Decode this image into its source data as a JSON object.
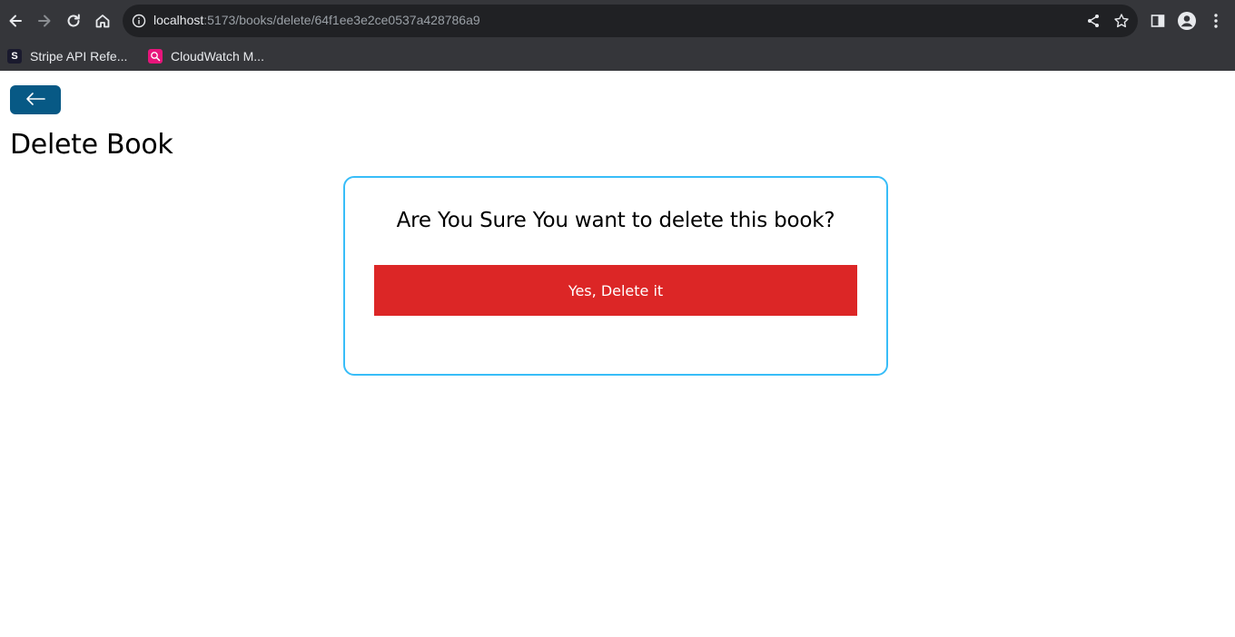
{
  "browser": {
    "url_host": "localhost",
    "url_path": ":5173/books/delete/64f1ee3e2ce0537a428786a9",
    "bookmarks": [
      {
        "label": "Stripe API Refe...",
        "favicon_letter": "S",
        "favicon_color": "#1a1a2e",
        "icon": "stripe-icon"
      },
      {
        "label": "CloudWatch M...",
        "favicon_letter": "",
        "favicon_color": "#e7157b",
        "icon": "cloudwatch-icon"
      }
    ]
  },
  "page": {
    "back_icon": "arrow-left-icon",
    "back_button_color": "#075985",
    "title": "Delete Book",
    "confirm": {
      "question": "Are You Sure You want to delete this book?",
      "delete_label": "Yes, Delete it",
      "delete_color": "#dc2626",
      "border_color": "#38bdf8"
    }
  }
}
